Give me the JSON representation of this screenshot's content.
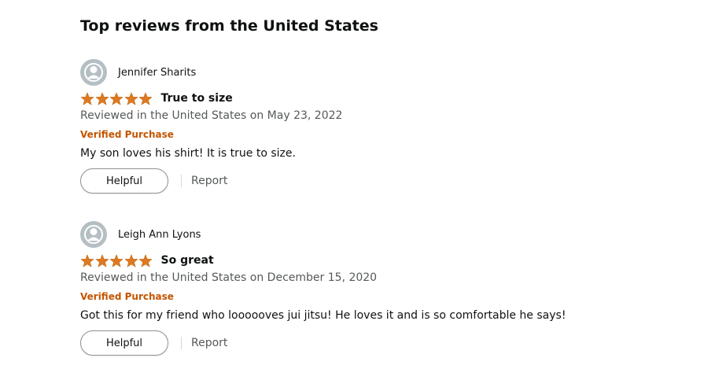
{
  "section": {
    "title": "Top reviews from the United States"
  },
  "colors": {
    "star": "#de7921",
    "verified": "#c45500",
    "secondary_text": "#565959",
    "avatar_bg": "#b5bfc3"
  },
  "reviews": [
    {
      "reviewer": "Jennifer Sharits",
      "avatar_icon": "user-silhouette-icon",
      "rating": 5,
      "rating_max": 5,
      "title": "True to size",
      "date": "Reviewed in the United States on May 23, 2022",
      "verified": "Verified Purchase",
      "body": "My son loves his shirt! It is true to size.",
      "helpful_label": "Helpful",
      "report_label": "Report"
    },
    {
      "reviewer": "Leigh Ann Lyons",
      "avatar_icon": "user-silhouette-icon",
      "rating": 5,
      "rating_max": 5,
      "title": "So great",
      "date": "Reviewed in the United States on December 15, 2020",
      "verified": "Verified Purchase",
      "body": "Got this for my friend who loooooves jui jitsu! He loves it and is so comfortable he says!",
      "helpful_label": "Helpful",
      "report_label": "Report"
    }
  ]
}
